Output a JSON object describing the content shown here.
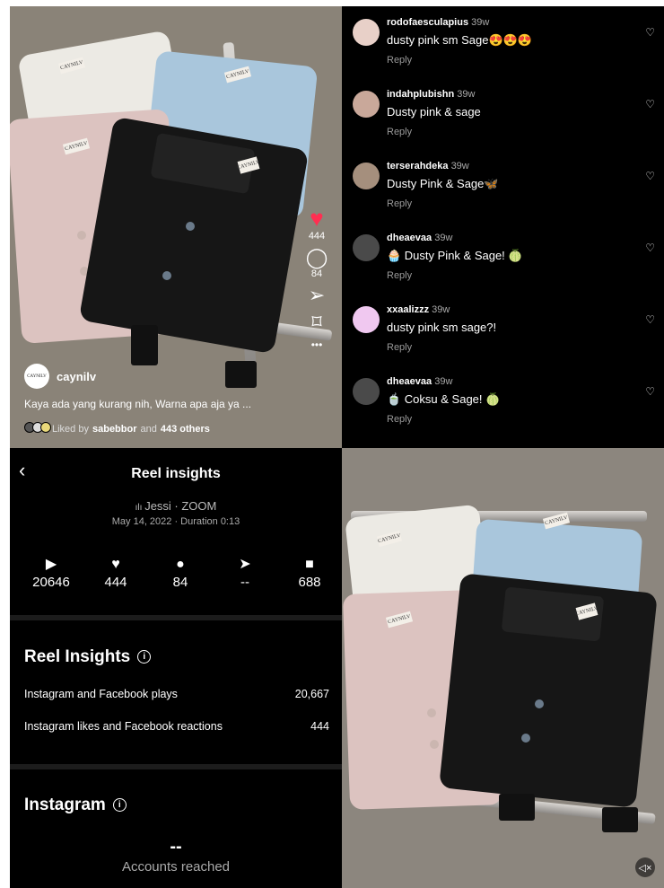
{
  "reel": {
    "likes_count": "444",
    "comments_count": "84",
    "username": "caynilv",
    "logo_text": "CAYNILV",
    "caption": "Kaya ada yang kurang nih, Warna apa aja ya ...",
    "liked_by_prefix": "Liked by",
    "liked_by_user": "sabebbor",
    "liked_by_suffix": "and",
    "liked_by_others": "443 others",
    "more_label": "•••"
  },
  "comments": [
    {
      "user": "rodofaesculapius",
      "time": "39w",
      "text": "dusty pink sm Sage😍😍😍",
      "reply": "Reply",
      "avatar_color": "#e8d0c8"
    },
    {
      "user": "indahplubishn",
      "time": "39w",
      "text": "Dusty pink & sage",
      "reply": "Reply",
      "avatar_color": "#c9a89a"
    },
    {
      "user": "terserahdeka",
      "time": "39w",
      "text": "Dusty Pink & Sage🦋",
      "reply": "Reply",
      "avatar_color": "#a58f7d"
    },
    {
      "user": "dheaevaa",
      "time": "39w",
      "text": "🧁 Dusty Pink & Sage! 🍈",
      "reply": "Reply",
      "avatar_color": "#4a4a4a"
    },
    {
      "user": "xxaalizzz",
      "time": "39w",
      "text": "dusty pink sm sage?!",
      "reply": "Reply",
      "avatar_color": "#f0c8f0"
    },
    {
      "user": "dheaevaa",
      "time": "39w",
      "text": "🍵 Coksu & Sage! 🍈",
      "reply": "Reply",
      "avatar_color": "#4a4a4a"
    }
  ],
  "insights": {
    "title": "Reel insights",
    "audio": "Jessi · ZOOM",
    "date": "May 14, 2022 · Duration 0:13",
    "stats": [
      {
        "icon": "play-icon",
        "glyph": "▶",
        "value": "20646"
      },
      {
        "icon": "heart-icon",
        "glyph": "♥",
        "value": "444"
      },
      {
        "icon": "comment-icon",
        "glyph": "●",
        "value": "84"
      },
      {
        "icon": "share-icon",
        "glyph": "➤",
        "value": "--"
      },
      {
        "icon": "save-icon",
        "glyph": "■",
        "value": "688"
      }
    ],
    "section1_title": "Reel Insights",
    "rows": [
      {
        "label": "Instagram and Facebook plays",
        "value": "20,667"
      },
      {
        "label": "Instagram likes and Facebook reactions",
        "value": "444"
      }
    ],
    "section2_title": "Instagram",
    "accounts_value": "--",
    "accounts_label": "Accounts reached"
  },
  "colors": {
    "like_red": "#ff2e51",
    "shirt_white": "#eceae4",
    "shirt_blue": "#a9c6dc",
    "shirt_pink": "#dcc3c0",
    "shirt_black": "#161616"
  }
}
